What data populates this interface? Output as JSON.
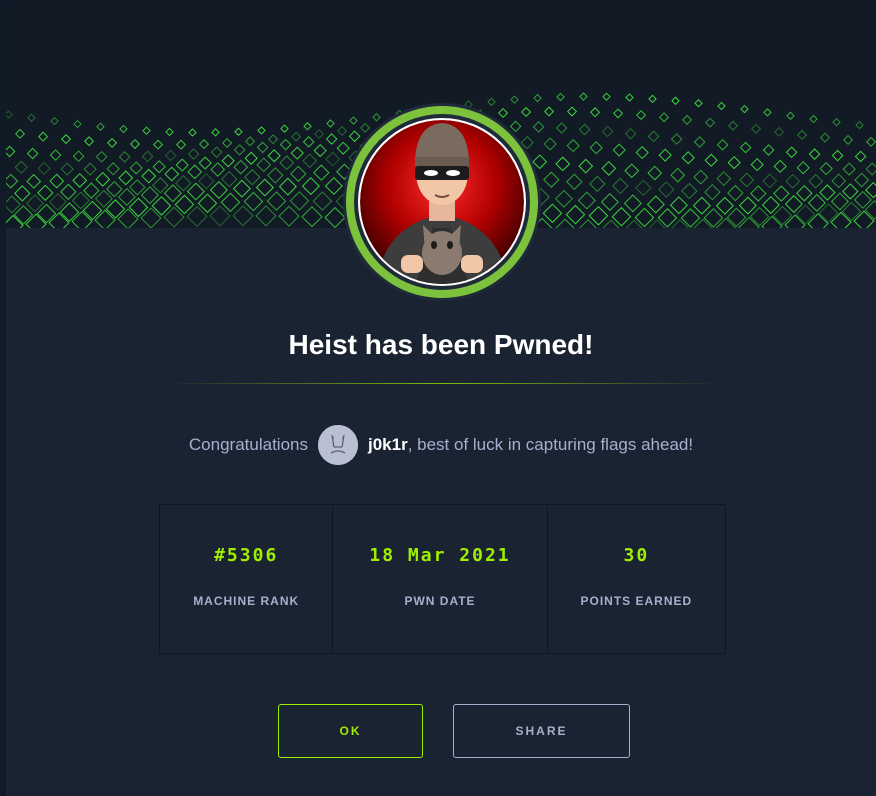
{
  "modal": {
    "title": "Heist has been Pwned!",
    "congrats": {
      "prefix": "Congratulations",
      "username": "j0k1r",
      "suffix": ", best of luck in capturing flags ahead!"
    },
    "stats": [
      {
        "value": "#5306",
        "label": "MACHINE RANK"
      },
      {
        "value": "18 Mar 2021",
        "label": "PWN DATE"
      },
      {
        "value": "30",
        "label": "POINTS EARNED"
      }
    ],
    "buttons": {
      "ok": "OK",
      "share": "SHARE"
    }
  },
  "icons": {
    "banner": "matrix-wave-banner",
    "machine_avatar": "heist-thief-avatar",
    "user_avatar": "user-avatar-icon"
  },
  "colors": {
    "accent_green": "#9fef00",
    "background": "#1a2332",
    "text_muted": "#a4b1cd",
    "ring": "#7cc23d"
  }
}
